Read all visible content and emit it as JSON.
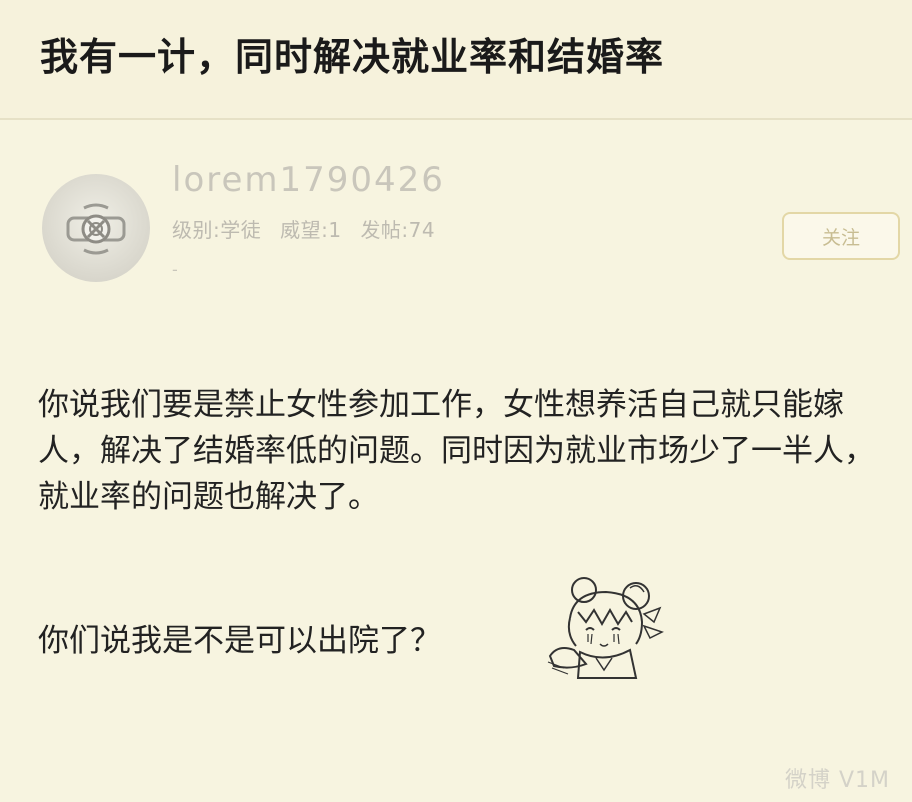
{
  "thread": {
    "title": "我有一计，同时解决就业率和结婚率"
  },
  "post": {
    "author": {
      "username": "lorem1790426",
      "level_label": "级别:学徒",
      "prestige_label": "威望:1",
      "posts_label": "发帖:74",
      "dash": "-"
    },
    "follow_button_label": "关注",
    "body": {
      "paragraph_1": "你说我们要是禁止女性参加工作，女性想养活自己就只能嫁人，解决了结婚率低的问题。同时因为就业市场少了一半人，就业率的问题也解决了。",
      "paragraph_2": "你们说我是不是可以出院了？"
    },
    "sticker_icon": "anime-girl-sticker-icon"
  },
  "watermark": {
    "text": "微博 V1M"
  },
  "colors": {
    "background": "#f6f2dc",
    "text": "#222222",
    "muted": "#c9c6bb",
    "button_border": "#e3d7a6"
  }
}
